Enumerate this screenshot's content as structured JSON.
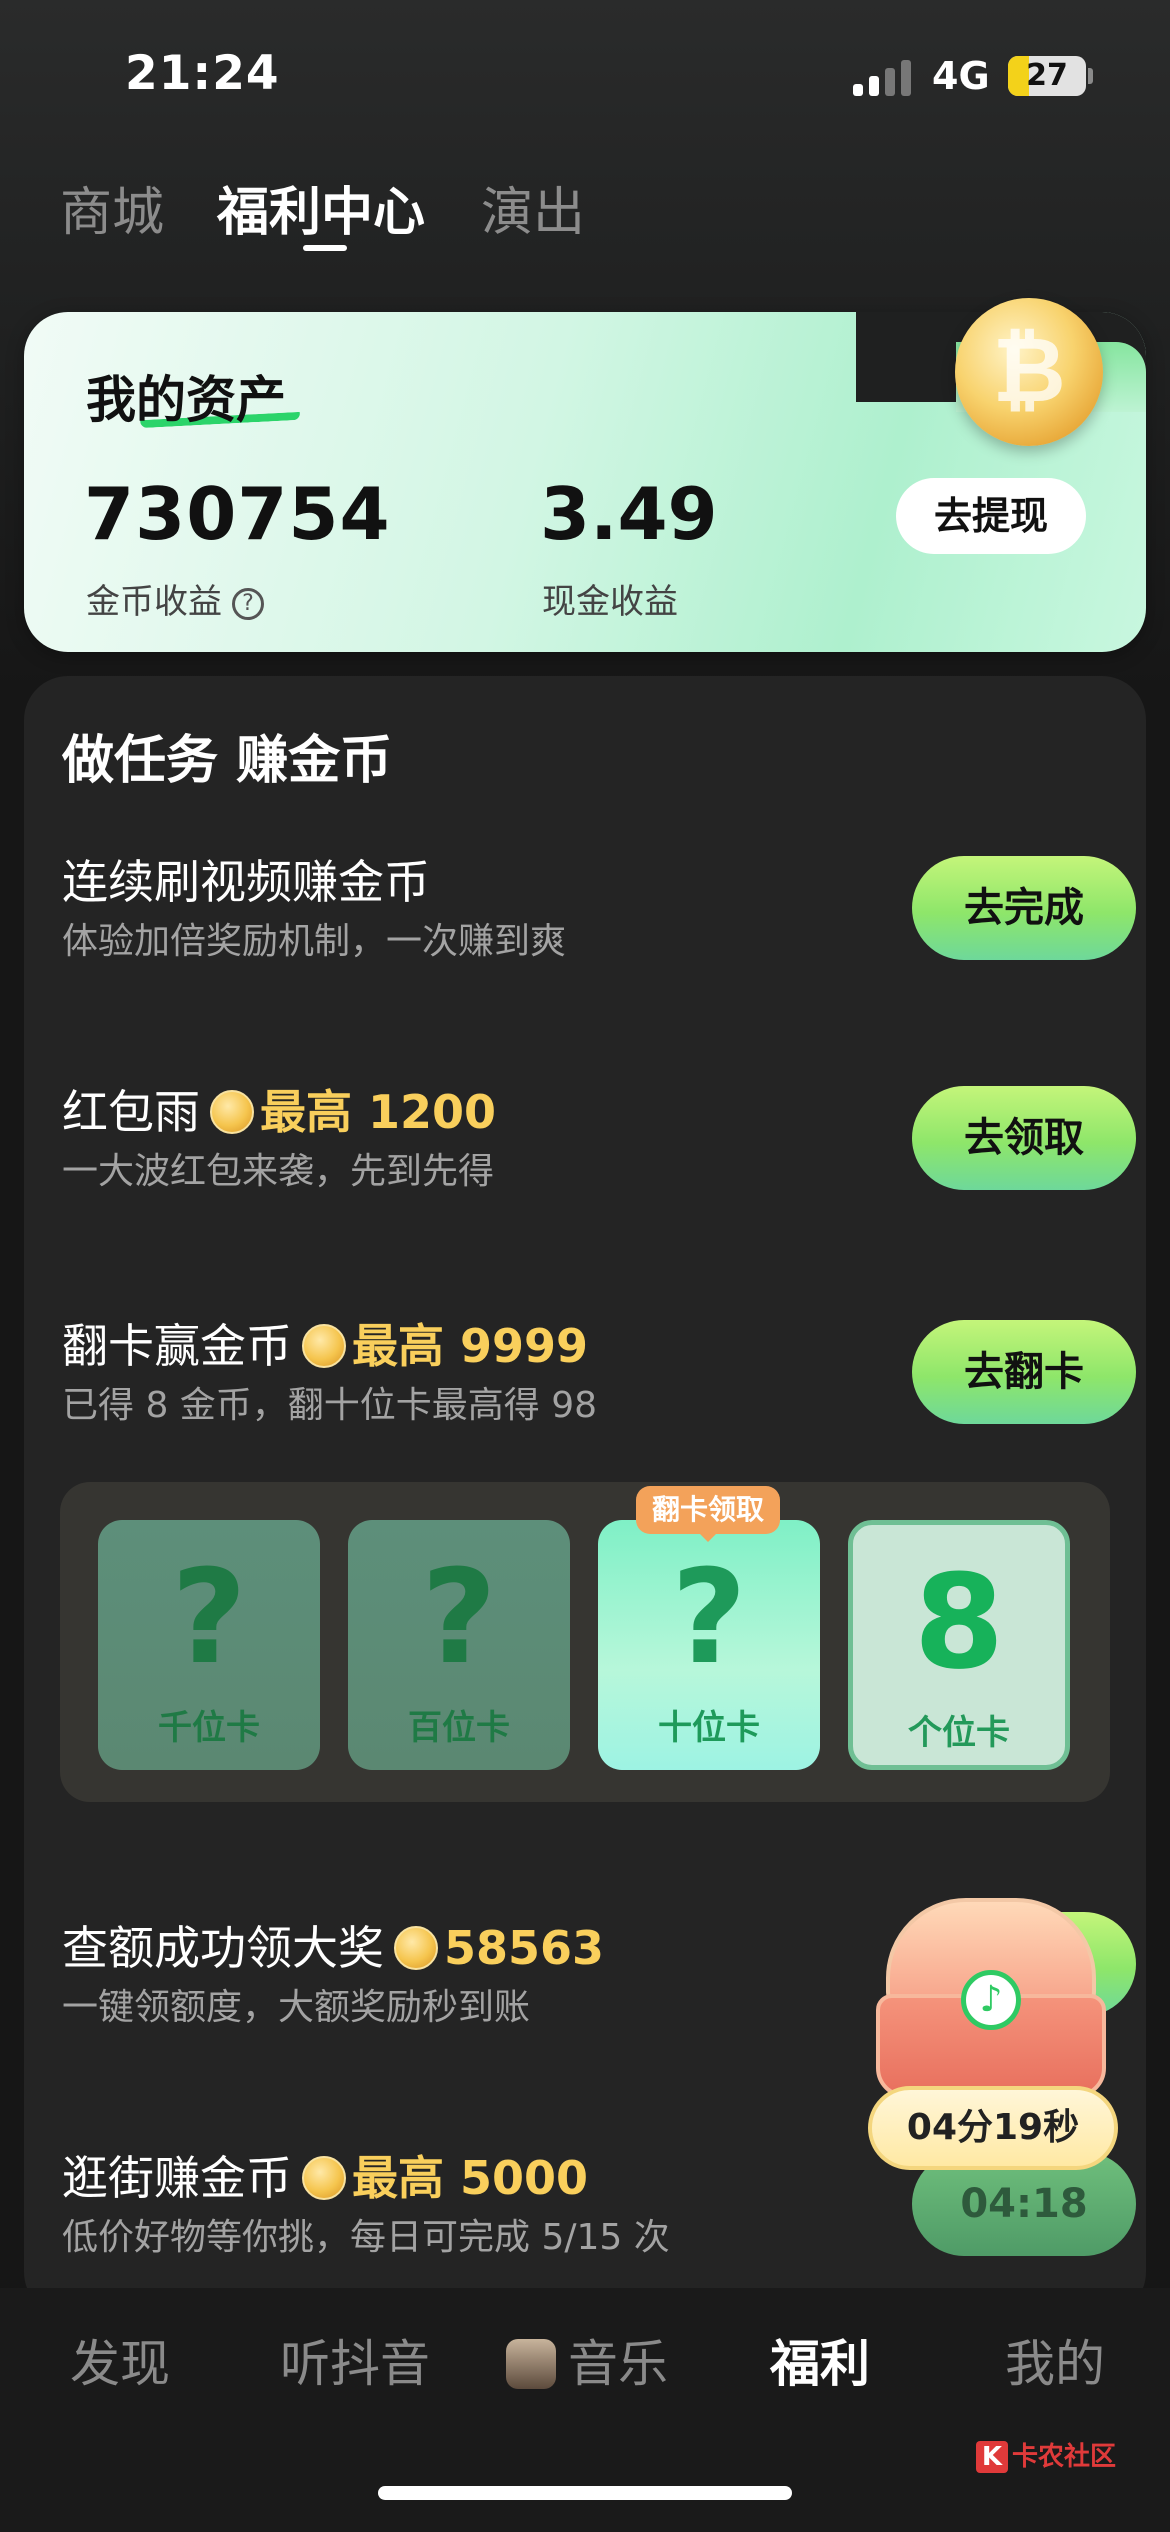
{
  "status_bar": {
    "time": "21:24",
    "network": "4G",
    "battery": "27"
  },
  "top_tabs": [
    {
      "label": "商城",
      "active": false
    },
    {
      "label": "福利中心",
      "active": true
    },
    {
      "label": "演出",
      "active": false
    }
  ],
  "assets": {
    "title": "我的资产",
    "coins_value": "730754",
    "coins_label": "金币收益",
    "help_symbol": "?",
    "cash_value": "3.49",
    "cash_label": "现金收益",
    "withdraw_label": "去提现"
  },
  "tasks_section": {
    "title": "做任务 赚金币",
    "tasks": [
      {
        "title": "连续刷视频赚金币",
        "highlight": "",
        "desc": "体验加倍奖励机制，一次赚到爽",
        "button": "去完成"
      },
      {
        "title": "红包雨",
        "highlight": "最高 1200",
        "desc": "一大波红包来袭，先到先得",
        "button": "去领取"
      },
      {
        "title": "翻卡赢金币",
        "highlight": "最高 9999",
        "desc": "已得 8 金币，翻十位卡最高得 98",
        "button": "去翻卡"
      },
      {
        "title": "查额成功领大奖",
        "highlight": "58563",
        "desc": "一键领额度，大额奖励秒到账",
        "button": ""
      },
      {
        "title": "逛街赚金币",
        "highlight": "最高 5000",
        "desc": "低价好物等你挑，每日可完成 5/15 次",
        "button": "04:18"
      }
    ],
    "flip_tag": "翻卡领取",
    "flip_cards": [
      {
        "symbol": "?",
        "label": "千位卡"
      },
      {
        "symbol": "?",
        "label": "百位卡"
      },
      {
        "symbol": "?",
        "label": "十位卡"
      },
      {
        "symbol": "8",
        "label": "个位卡"
      }
    ]
  },
  "floating_chest": {
    "lock_symbol": "♪",
    "countdown": "04分19秒"
  },
  "bottom_nav": [
    {
      "label": "发现",
      "active": false
    },
    {
      "label": "听抖音",
      "active": false
    },
    {
      "label": "音乐",
      "active": false
    },
    {
      "label": "福利",
      "active": true
    },
    {
      "label": "我的",
      "active": false
    }
  ],
  "watermark": {
    "mark": "K",
    "text": "卡农社区"
  },
  "colors": {
    "accent_green": "#8ee66a",
    "gold": "#f9cf5c",
    "background": "#161616"
  }
}
